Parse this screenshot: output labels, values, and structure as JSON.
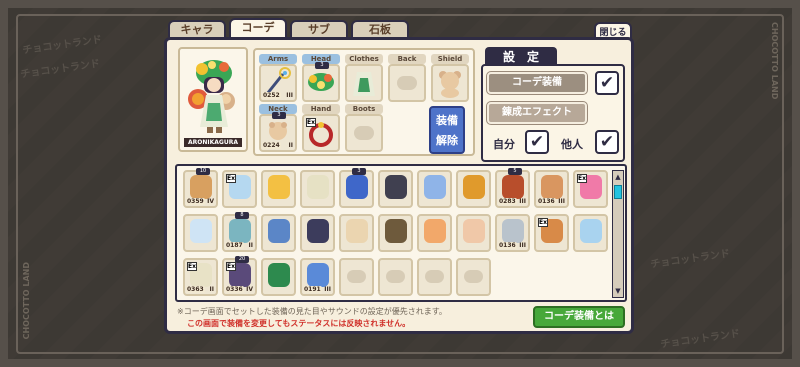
{
  "tabs": [
    {
      "label": "キャラ"
    },
    {
      "label": "コーデ"
    },
    {
      "label": "サブ"
    },
    {
      "label": "石板"
    }
  ],
  "close": {
    "label": "閉じる",
    "glyph": "✕"
  },
  "watermark": "チョコットランド",
  "side_text": "CHOCOTTO LAND",
  "character": {
    "name": "ARONIKAGURA"
  },
  "equip_slots": {
    "arms": {
      "label": "Arms",
      "level": "0252",
      "rank": "III"
    },
    "head": {
      "label": "Head",
      "badge": "3"
    },
    "clothes": {
      "label": "Clothes"
    },
    "back": {
      "label": "Back"
    },
    "shield": {
      "label": "Shield"
    },
    "neck": {
      "label": "Neck",
      "level": "0224",
      "rank": "II",
      "badge": "3"
    },
    "hand": {
      "label": "Hand",
      "ex": "Ex"
    },
    "boots": {
      "label": "Boots"
    }
  },
  "equip_remove": {
    "line1": "装備",
    "line2": "解除"
  },
  "settings": {
    "title": "設　定",
    "coord_equip": "コーデ装備",
    "coord_equip_checked": "✔",
    "refine_effect": "錬成エフェクト",
    "self_label": "自分",
    "self_checked": "✔",
    "others_label": "他人",
    "others_checked": "✔"
  },
  "inventory": {
    "rows": [
      [
        {
          "item": true,
          "color": "#d8a060",
          "level": "0359",
          "rank": "IV",
          "badge": "10"
        },
        {
          "item": true,
          "color": "#b5d8f0",
          "ex": "Ex"
        },
        {
          "item": true,
          "color": "#f3c043"
        },
        {
          "item": true,
          "color": "#e6e1c4"
        },
        {
          "item": true,
          "color": "#3f67c9",
          "badge": "3"
        },
        {
          "item": true,
          "color": "#404050"
        },
        {
          "item": true,
          "color": "#8fb4e8"
        },
        {
          "item": true,
          "color": "#e09a2c"
        },
        {
          "item": true,
          "color": "#b84e2c",
          "level": "0283",
          "rank": "III",
          "badge": "5"
        },
        {
          "item": true,
          "color": "#d99660",
          "level": "0136",
          "rank": "III"
        }
      ],
      [
        {
          "item": true,
          "color": "#f07aa8",
          "ex": "Ex"
        },
        {
          "item": true,
          "color": "#cfe4f5"
        },
        {
          "item": true,
          "color": "#7bb5c0",
          "level": "0187",
          "rank": "II",
          "badge": "8"
        },
        {
          "item": true,
          "color": "#5b86c7"
        },
        {
          "item": true,
          "color": "#3c3c5c"
        },
        {
          "item": true,
          "color": "#ebd5b0"
        },
        {
          "item": true,
          "color": "#6e5a3c"
        },
        {
          "item": true,
          "color": "#f2a86a"
        },
        {
          "item": true,
          "color": "#f0c8a8"
        },
        {
          "item": true,
          "color": "#b9c3cc",
          "level": "0136",
          "rank": "III"
        }
      ],
      [
        {
          "item": true,
          "color": "#d88a48",
          "ex": "Ex"
        },
        {
          "item": true,
          "color": "#a9d3ef"
        },
        {
          "item": true,
          "color": "#e8e2c6",
          "level": "0363",
          "rank": "II",
          "ex": "Ex"
        },
        {
          "item": true,
          "color": "#5a4a7a",
          "level": "0336",
          "rank": "IV",
          "badge": "20",
          "ex": "Ex"
        },
        {
          "item": true,
          "color": "#2d8a4e"
        },
        {
          "item": true,
          "color": "#5a8ad8",
          "level": "0191",
          "rank": "III"
        },
        {
          "item": false
        },
        {
          "item": false
        },
        {
          "item": false
        },
        {
          "item": false
        }
      ]
    ]
  },
  "notes": {
    "line1": "※コーデ画面でセットした装備の見た目やサウンドの設定が優先されます。",
    "line2": "この画面で装備を変更してもステータスには反映されません。"
  },
  "help_button": {
    "label": "コーデ装備とは"
  }
}
